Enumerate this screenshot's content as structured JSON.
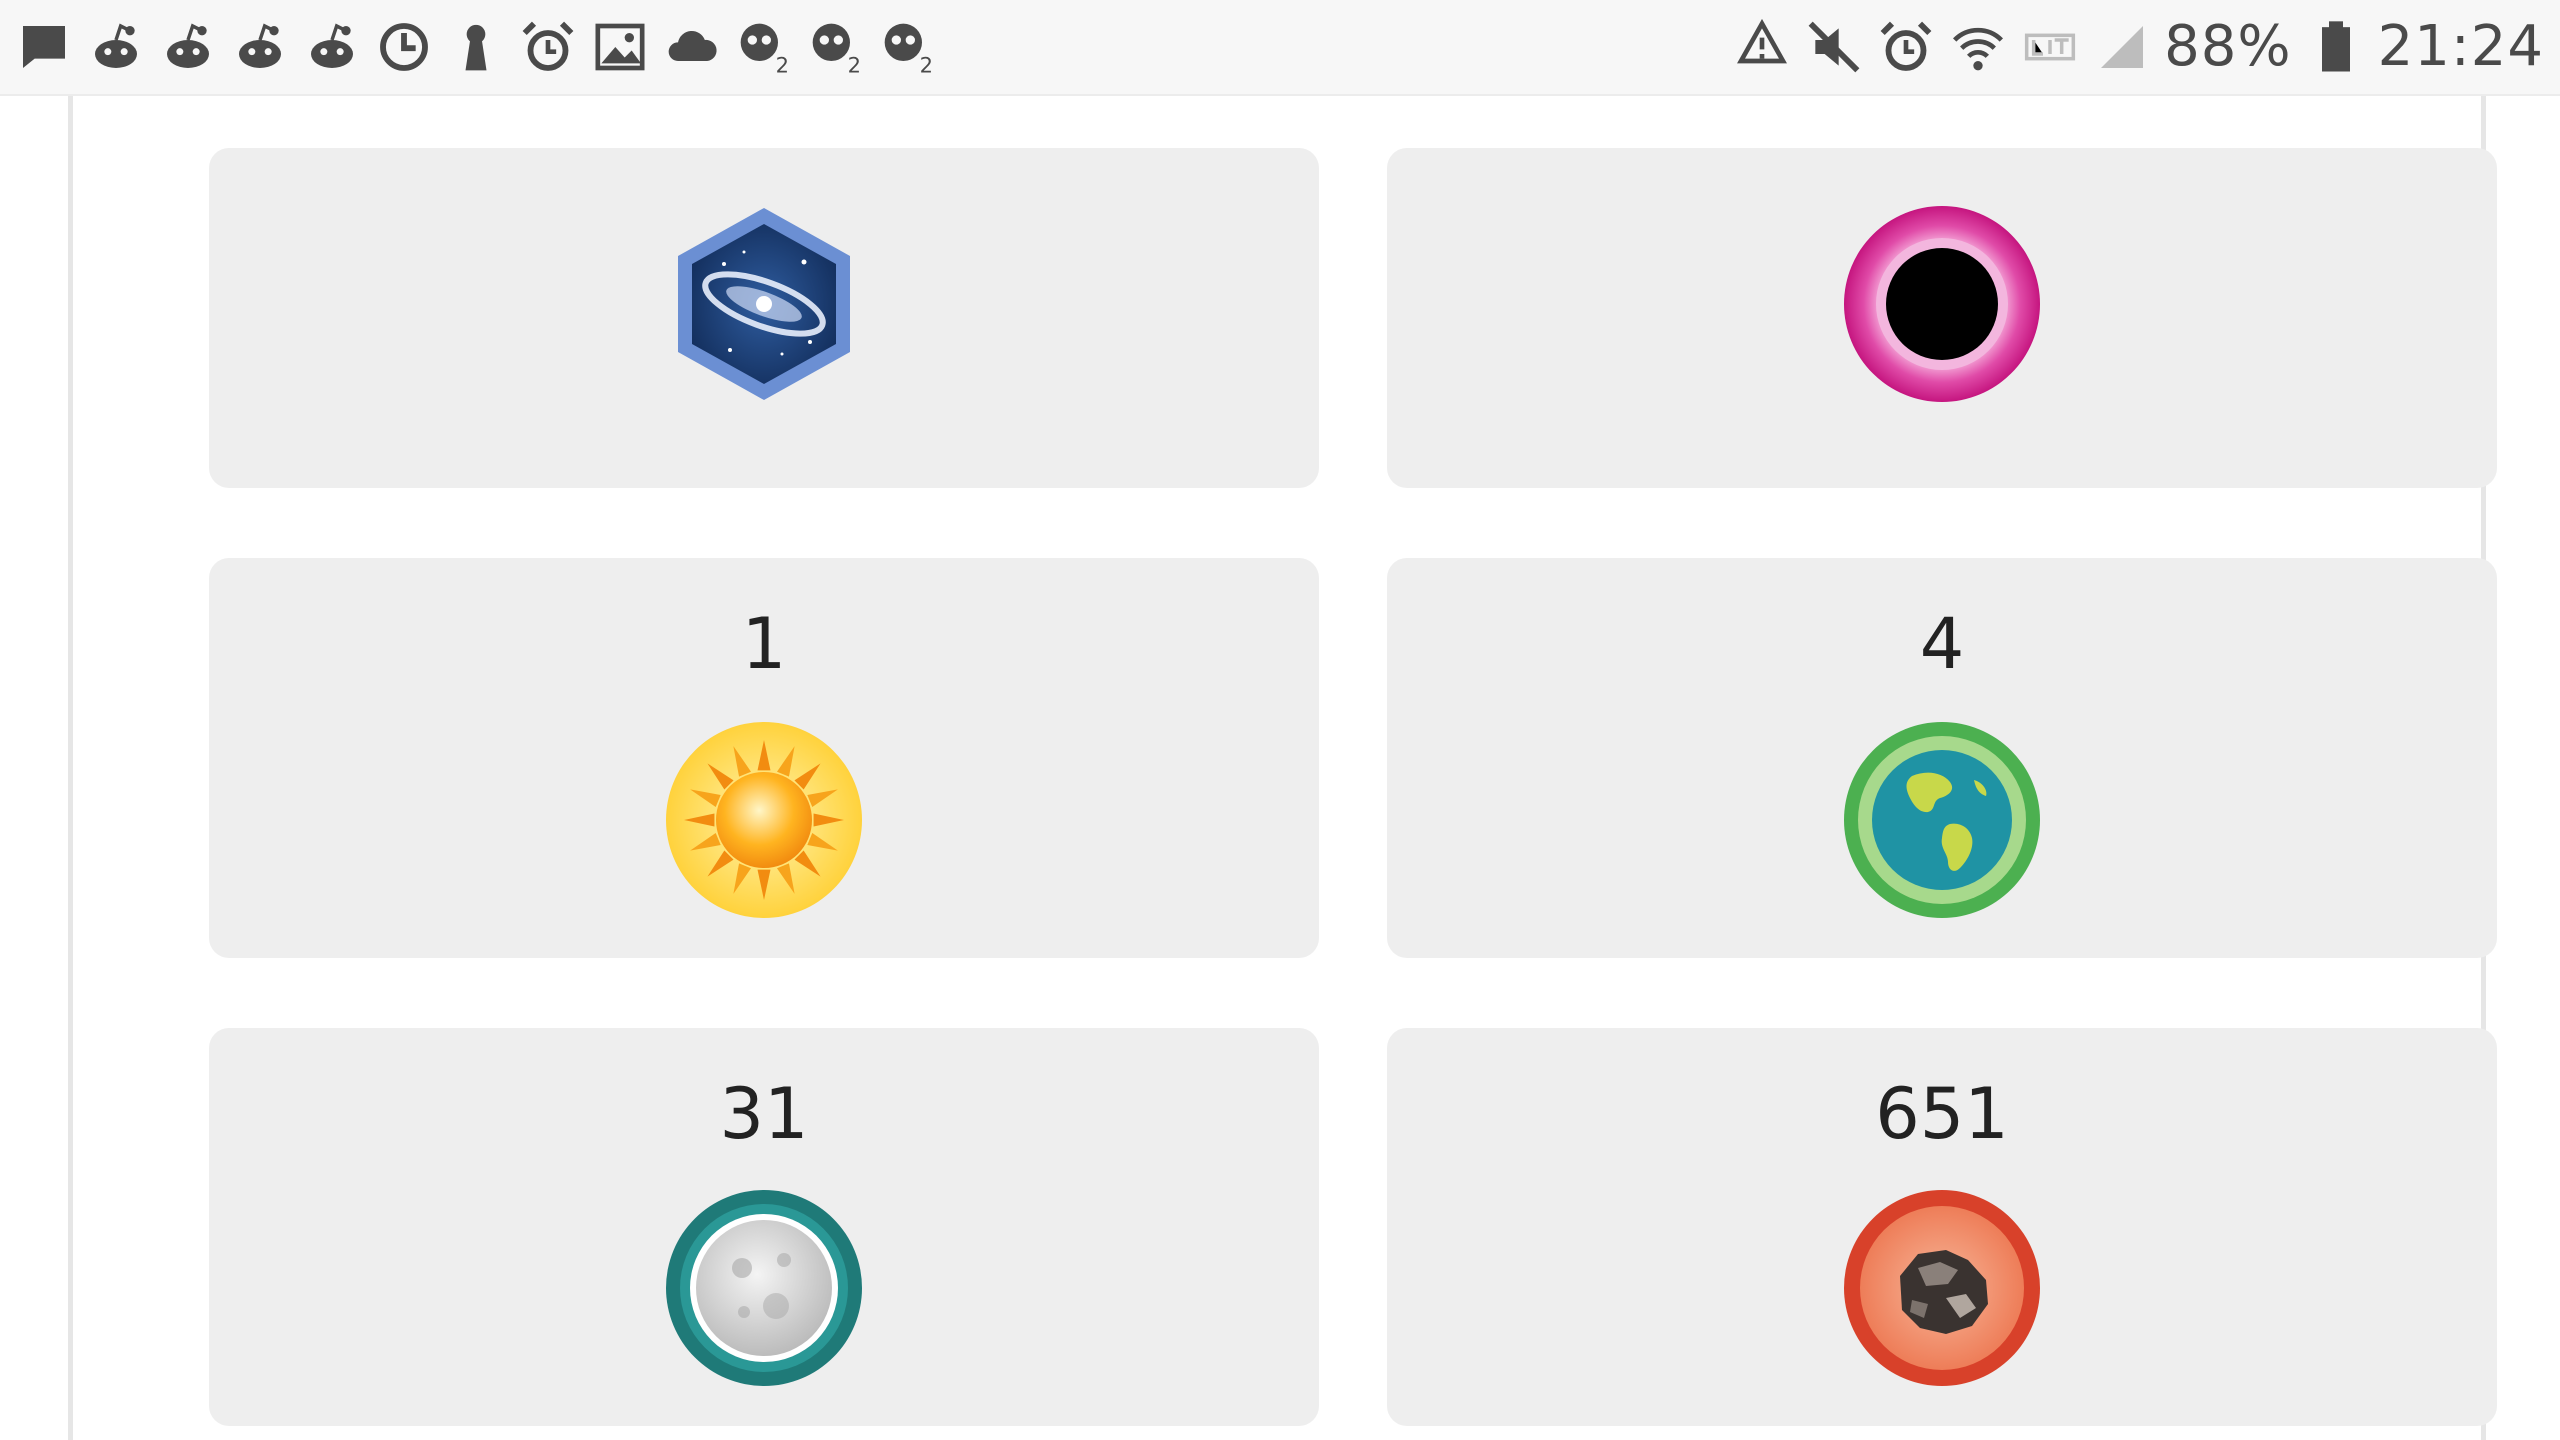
{
  "status_bar": {
    "battery": "88%",
    "time": "21:24",
    "left_icons": [
      "message-icon",
      "reddit-icon",
      "reddit-icon",
      "reddit-icon",
      "reddit-icon",
      "clock-icon",
      "keyhole-icon",
      "alarm-icon",
      "image-icon",
      "cloud-icon",
      "game-notification-icon",
      "game-notification-icon",
      "game-notification-icon"
    ],
    "right_icons": [
      "sync-icon",
      "mute-icon",
      "alarm-icon",
      "wifi-icon",
      "lte-icon",
      "signal-icon",
      "battery-icon"
    ]
  },
  "badges": [
    {
      "count": "",
      "icon": "galaxy-badge-icon"
    },
    {
      "count": "",
      "icon": "black-hole-badge-icon"
    },
    {
      "count": "1",
      "icon": "sun-badge-icon"
    },
    {
      "count": "4",
      "icon": "earth-badge-icon"
    },
    {
      "count": "31",
      "icon": "moon-badge-icon"
    },
    {
      "count": "651",
      "icon": "asteroid-badge-icon"
    }
  ],
  "colors": {
    "card_background": "#eeeeee",
    "galaxy": "#3b6ab3",
    "black_hole_ring": "#d6208e",
    "sun": "#f5a623",
    "earth_ring": "#4cb050",
    "moon_ring": "#1f7a78",
    "asteroid_ring": "#d8412a"
  }
}
